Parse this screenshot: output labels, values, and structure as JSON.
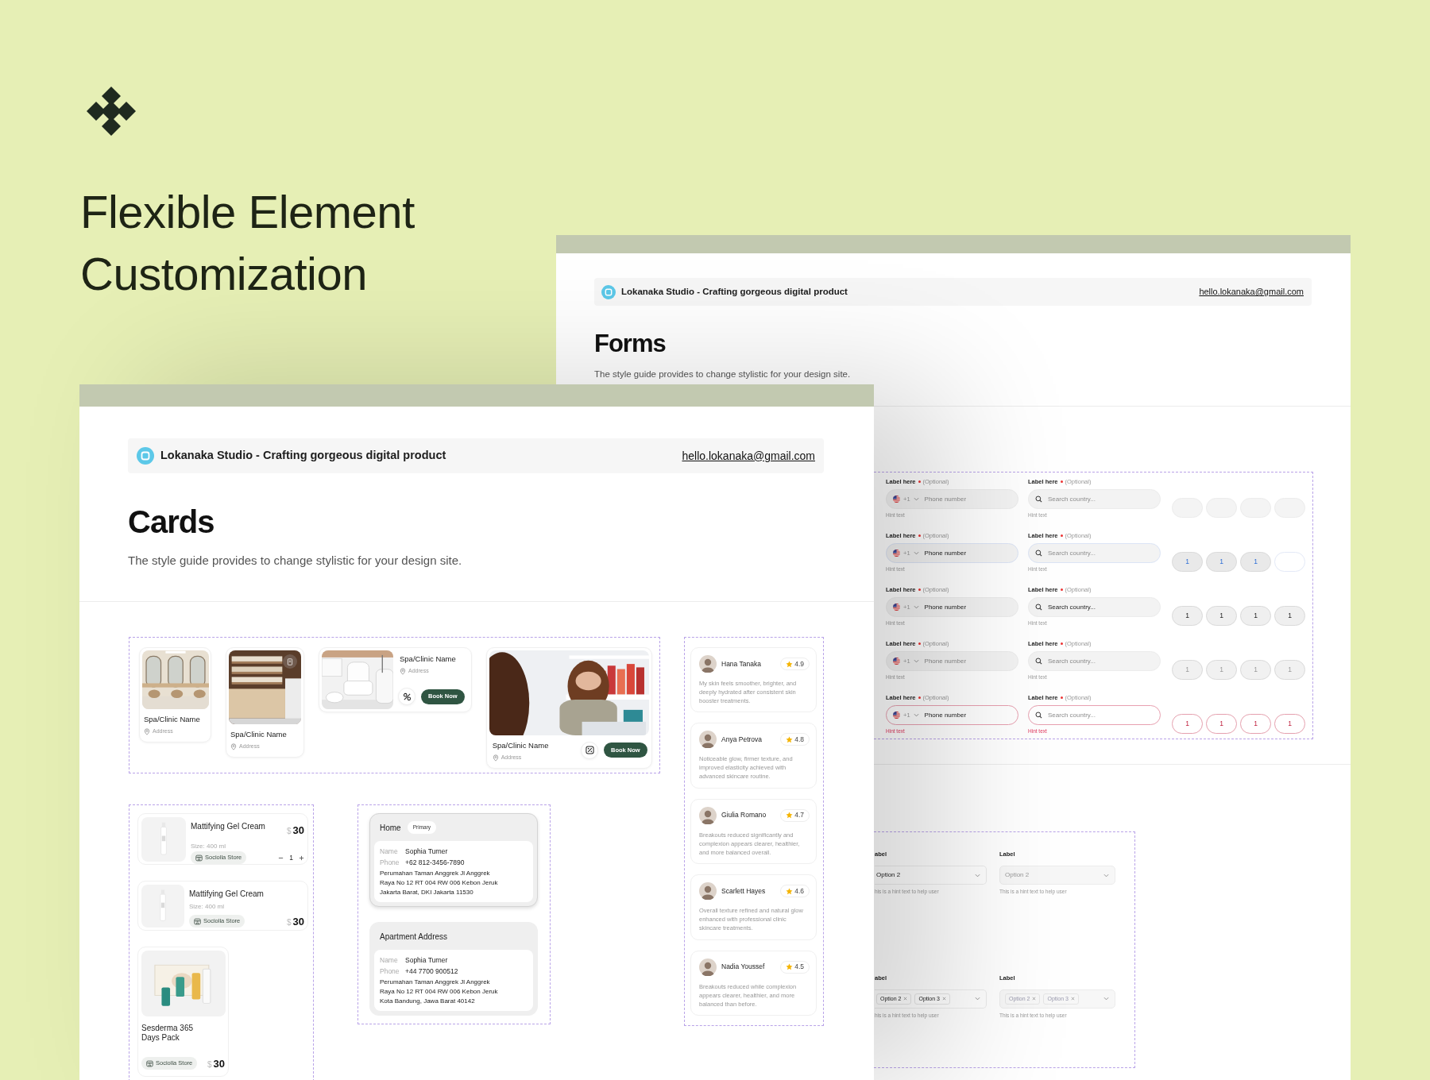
{
  "headline_lines": [
    "Flexible Element",
    "Customization"
  ],
  "forms_window": {
    "header": {
      "title": "Lokanaka Studio - Crafting gorgeous digital product",
      "email": "hello.lokanaka@gmail.com"
    },
    "title": "Forms",
    "subtitle": "The style guide provides to change stylistic for your design site.",
    "field_rows": [
      {
        "kind": "default",
        "phone": {
          "label": "Label here",
          "required": true,
          "optional": "(Optional)",
          "code": "+1",
          "placeholder": "Phone number",
          "hint": "Hint text"
        },
        "search": {
          "label": "Label here",
          "required": true,
          "optional": "(Optional)",
          "placeholder": "Search country...",
          "hint": "Hint text"
        },
        "otp": [
          {
            "filled": false
          },
          {
            "filled": false
          },
          {
            "filled": false
          },
          {
            "filled": false
          }
        ]
      },
      {
        "kind": "focus",
        "phone": {
          "label": "Label here",
          "required": true,
          "optional": "(Optional)",
          "code": "+1",
          "value": "Phone number",
          "hint": "Hint text"
        },
        "search": {
          "label": "Label here",
          "required": true,
          "optional": "(Optional)",
          "placeholder": "Search country...",
          "hint": "Hint text"
        },
        "otp": [
          {
            "filled": true,
            "value": "1"
          },
          {
            "filled": true,
            "value": "1"
          },
          {
            "filled": true,
            "value": "1"
          },
          {
            "filled": false
          }
        ]
      },
      {
        "kind": "filled",
        "phone": {
          "label": "Label here",
          "required": true,
          "optional": "(Optional)",
          "code": "+1",
          "value": "Phone number",
          "hint": "Hint text"
        },
        "search": {
          "label": "Label here",
          "required": true,
          "optional": "(Optional)",
          "value": "Search country...",
          "hint": "Hint text"
        },
        "otp": [
          {
            "filled": true,
            "value": "1"
          },
          {
            "filled": true,
            "value": "1"
          },
          {
            "filled": true,
            "value": "1"
          },
          {
            "filled": true,
            "value": "1"
          }
        ]
      },
      {
        "kind": "disabled",
        "phone": {
          "label": "Label here",
          "required": true,
          "optional": "(Optional)",
          "code": "+1",
          "placeholder": "Phone number",
          "hint": "Hint text"
        },
        "search": {
          "label": "Label here",
          "required": true,
          "optional": "(Optional)",
          "placeholder": "Search country...",
          "hint": "Hint text"
        },
        "otp": [
          {
            "filled": true,
            "value": "1"
          },
          {
            "filled": true,
            "value": "1"
          },
          {
            "filled": true,
            "value": "1"
          },
          {
            "filled": true,
            "value": "1"
          }
        ]
      },
      {
        "kind": "error",
        "phone": {
          "label": "Label here",
          "required": true,
          "optional": "(Optional)",
          "code": "+1",
          "value": "Phone number",
          "hint": "Hint text"
        },
        "search": {
          "label": "Label here",
          "required": true,
          "optional": "(Optional)",
          "placeholder": "Search country...",
          "hint": "Hint text"
        },
        "otp": [
          {
            "filled": true,
            "value": "1"
          },
          {
            "filled": true,
            "value": "1"
          },
          {
            "filled": true,
            "value": "1"
          },
          {
            "filled": true,
            "value": "1"
          }
        ]
      }
    ],
    "selects": [
      {
        "kind": "single",
        "label": "abel",
        "value": "Option 2",
        "hint": "his is a hint text to help user",
        "disabled": false
      },
      {
        "kind": "single",
        "label": "Label",
        "value": "Option 2",
        "hint": "This is a hint text to help user",
        "disabled": true
      },
      {
        "kind": "multi",
        "label": "abel",
        "tags": [
          "Option 2",
          "Option 3"
        ],
        "hint": "his is a hint text to help user",
        "disabled": false
      },
      {
        "kind": "multi",
        "label": "Label",
        "tags": [
          "Option 2",
          "Option 3"
        ],
        "hint": "This is a hint text to help user",
        "disabled": true
      }
    ]
  },
  "cards_window": {
    "header": {
      "title": "Lokanaka Studio - Crafting gorgeous digital product",
      "email": "hello.lokanaka@gmail.com"
    },
    "title": "Cards",
    "subtitle": "The style guide provides to change stylistic for your design site.",
    "clinic_cards": [
      {
        "kind": "compact",
        "name": "Spa/Clinic Name",
        "address": "Address"
      },
      {
        "kind": "saved",
        "name": "Spa/Clinic Name",
        "address": "Address"
      },
      {
        "kind": "horizontal",
        "name": "Spa/Clinic Name",
        "address": "Address",
        "button": "Book Now"
      },
      {
        "kind": "featured",
        "name": "Spa/Clinic Name",
        "address": "Address",
        "button": "Book Now"
      }
    ],
    "product_cards": [
      {
        "kind": "cart",
        "name": "Mattifying Gel Cream",
        "size": "Size: 400 ml",
        "store": "Sociolla Store",
        "currency": "$",
        "price": "30",
        "quantity": "1"
      },
      {
        "kind": "row",
        "name": "Mattifying Gel Cream",
        "size": "Size: 400 ml",
        "store": "Sociolla Store",
        "currency": "$",
        "price": "30"
      },
      {
        "kind": "tile",
        "name": "Sesderma 365 Days Pack",
        "store": "Sociolla Store",
        "currency": "$",
        "price": "30"
      }
    ],
    "address_cards": [
      {
        "title": "Home",
        "badge": "Primary",
        "selected": true,
        "name_label": "Name",
        "name": "Sophia Turner",
        "phone_label": "Phone",
        "phone": "+62 812-3456-7890",
        "address_lines": [
          "Perumahan Taman Anggrek Jl Anggrek",
          "Raya No 12 RT 004 RW 006 Kebon Jeruk",
          "Jakarta Barat, DKI Jakarta 11530"
        ]
      },
      {
        "title": "Apartment Address",
        "selected": false,
        "name_label": "Name",
        "name": "Sophia Turner",
        "phone_label": "Phone",
        "phone": "+44 7700 900512",
        "address_lines": [
          "Perumahan Taman Anggrek Jl Anggrek",
          "Raya No 12 RT 004 RW 006 Kebon Jeruk",
          "Kota Bandung, Jawa Barat 40142"
        ]
      }
    ],
    "reviews": [
      {
        "name": "Hana Tanaka",
        "rating": "4.9",
        "text": "My skin feels smoother, brighter, and deeply hydrated after consistent skin booster treatments."
      },
      {
        "name": "Anya Petrova",
        "rating": "4.8",
        "text": "Noticeable glow, firmer texture, and improved elasticity achieved with advanced skincare routine."
      },
      {
        "name": "Giulia Romano",
        "rating": "4.7",
        "text": "Breakouts reduced significantly and complexion appears clearer, healthier, and more balanced overall."
      },
      {
        "name": "Scarlett Hayes",
        "rating": "4.6",
        "text": "Overall texture refined and natural glow enhanced with professional clinic skincare treatments."
      },
      {
        "name": "Nadia Youssef",
        "rating": "4.5",
        "text": "Breakouts reduced while complexion appears clearer, healthier, and more balanced than before."
      }
    ]
  }
}
